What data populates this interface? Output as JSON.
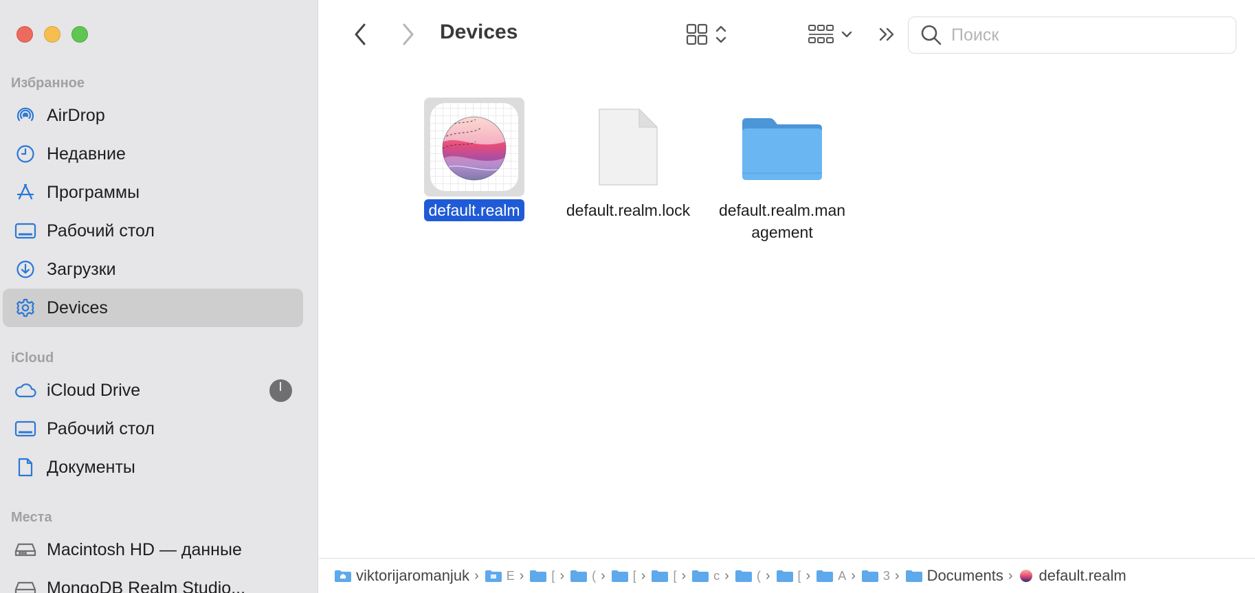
{
  "window": {
    "title": "Devices"
  },
  "colors": {
    "accent": "#1f5bd6",
    "folder": "#69b5f1",
    "sidebar_bg": "#e6e5e7"
  },
  "sidebar": {
    "sections": [
      {
        "title": "Избранное",
        "items": [
          {
            "label": "AirDrop",
            "icon": "airdrop-icon"
          },
          {
            "label": "Недавние",
            "icon": "clock-icon"
          },
          {
            "label": "Программы",
            "icon": "apps-icon"
          },
          {
            "label": "Рабочий стол",
            "icon": "desktop-icon"
          },
          {
            "label": "Загрузки",
            "icon": "download-icon"
          },
          {
            "label": "Devices",
            "icon": "gear-icon",
            "selected": true
          }
        ]
      },
      {
        "title": "iCloud",
        "items": [
          {
            "label": "iCloud Drive",
            "icon": "cloud-icon"
          },
          {
            "label": "Рабочий стол",
            "icon": "desktop-icon"
          },
          {
            "label": "Документы",
            "icon": "document-icon"
          }
        ]
      },
      {
        "title": "Места",
        "items": [
          {
            "label": "Macintosh HD — данные",
            "icon": "disk-icon"
          },
          {
            "label": "MongoDB Realm Studio...",
            "icon": "disk-icon"
          }
        ]
      }
    ]
  },
  "toolbar": {
    "search_placeholder": "Поиск"
  },
  "files": [
    {
      "name": "default.realm",
      "kind": "realm-file",
      "selected": true
    },
    {
      "name": "default.realm.lock",
      "kind": "document",
      "selected": false
    },
    {
      "name_line1": "default.realm.man",
      "name_line2": "agement",
      "kind": "folder",
      "selected": false
    }
  ],
  "pathbar": {
    "first": "viktorijaromanjuk",
    "middle": [
      "E",
      "[",
      "(",
      "[",
      "[",
      "c",
      "(",
      "[",
      "A",
      "3"
    ],
    "documents": "Documents",
    "last": "default.realm"
  }
}
